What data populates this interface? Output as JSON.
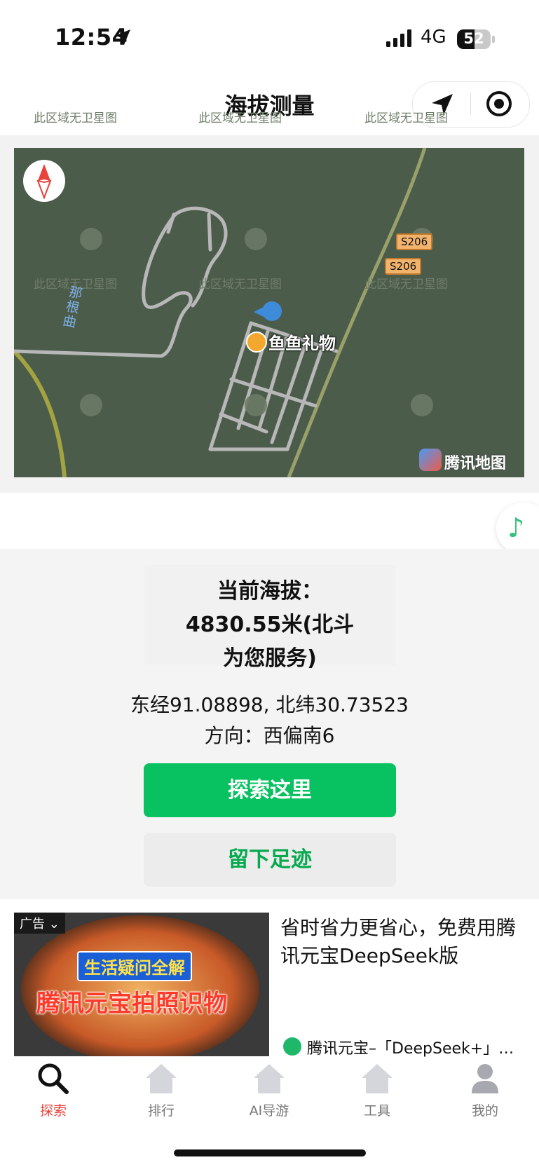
{
  "status_bar": {
    "time": "12:54",
    "network": "4G",
    "battery": 52,
    "battery_label": "52"
  },
  "nav": {
    "title": "海拔测量"
  },
  "map": {
    "watermark": "此区域无卫星图",
    "river_label": "那根曲",
    "road_label": "S206",
    "poi_label": "鱼鱼礼物",
    "brand": "腾讯地图"
  },
  "altitude": {
    "line1": "当前海拔：",
    "line2": "4830.55米(北斗",
    "line3": "为您服务)"
  },
  "coords": "东经91.08898, 北纬30.73523",
  "direction": "方向：西偏南6",
  "buttons": {
    "explore": "探索这里",
    "footprint": "留下足迹"
  },
  "ad": {
    "badge": "广告",
    "image_banner": "生活疑问全解",
    "image_headline": "腾讯元宝拍照识物",
    "title": "省时省力更省心，免费用腾讯元宝DeepSeek版",
    "source": "腾讯元宝–「DeepSeek+」…"
  },
  "tabs": [
    {
      "label": "探索",
      "icon": "search-icon",
      "active": true
    },
    {
      "label": "排行",
      "icon": "house-icon",
      "active": false
    },
    {
      "label": "AI导游",
      "icon": "house-icon",
      "active": false
    },
    {
      "label": "工具",
      "icon": "house-icon",
      "active": false
    },
    {
      "label": "我的",
      "icon": "person-icon",
      "active": false
    }
  ],
  "colors": {
    "primary_green": "#08c160",
    "active_tab": "#e8423b",
    "map_bg": "#4c5c4b"
  }
}
